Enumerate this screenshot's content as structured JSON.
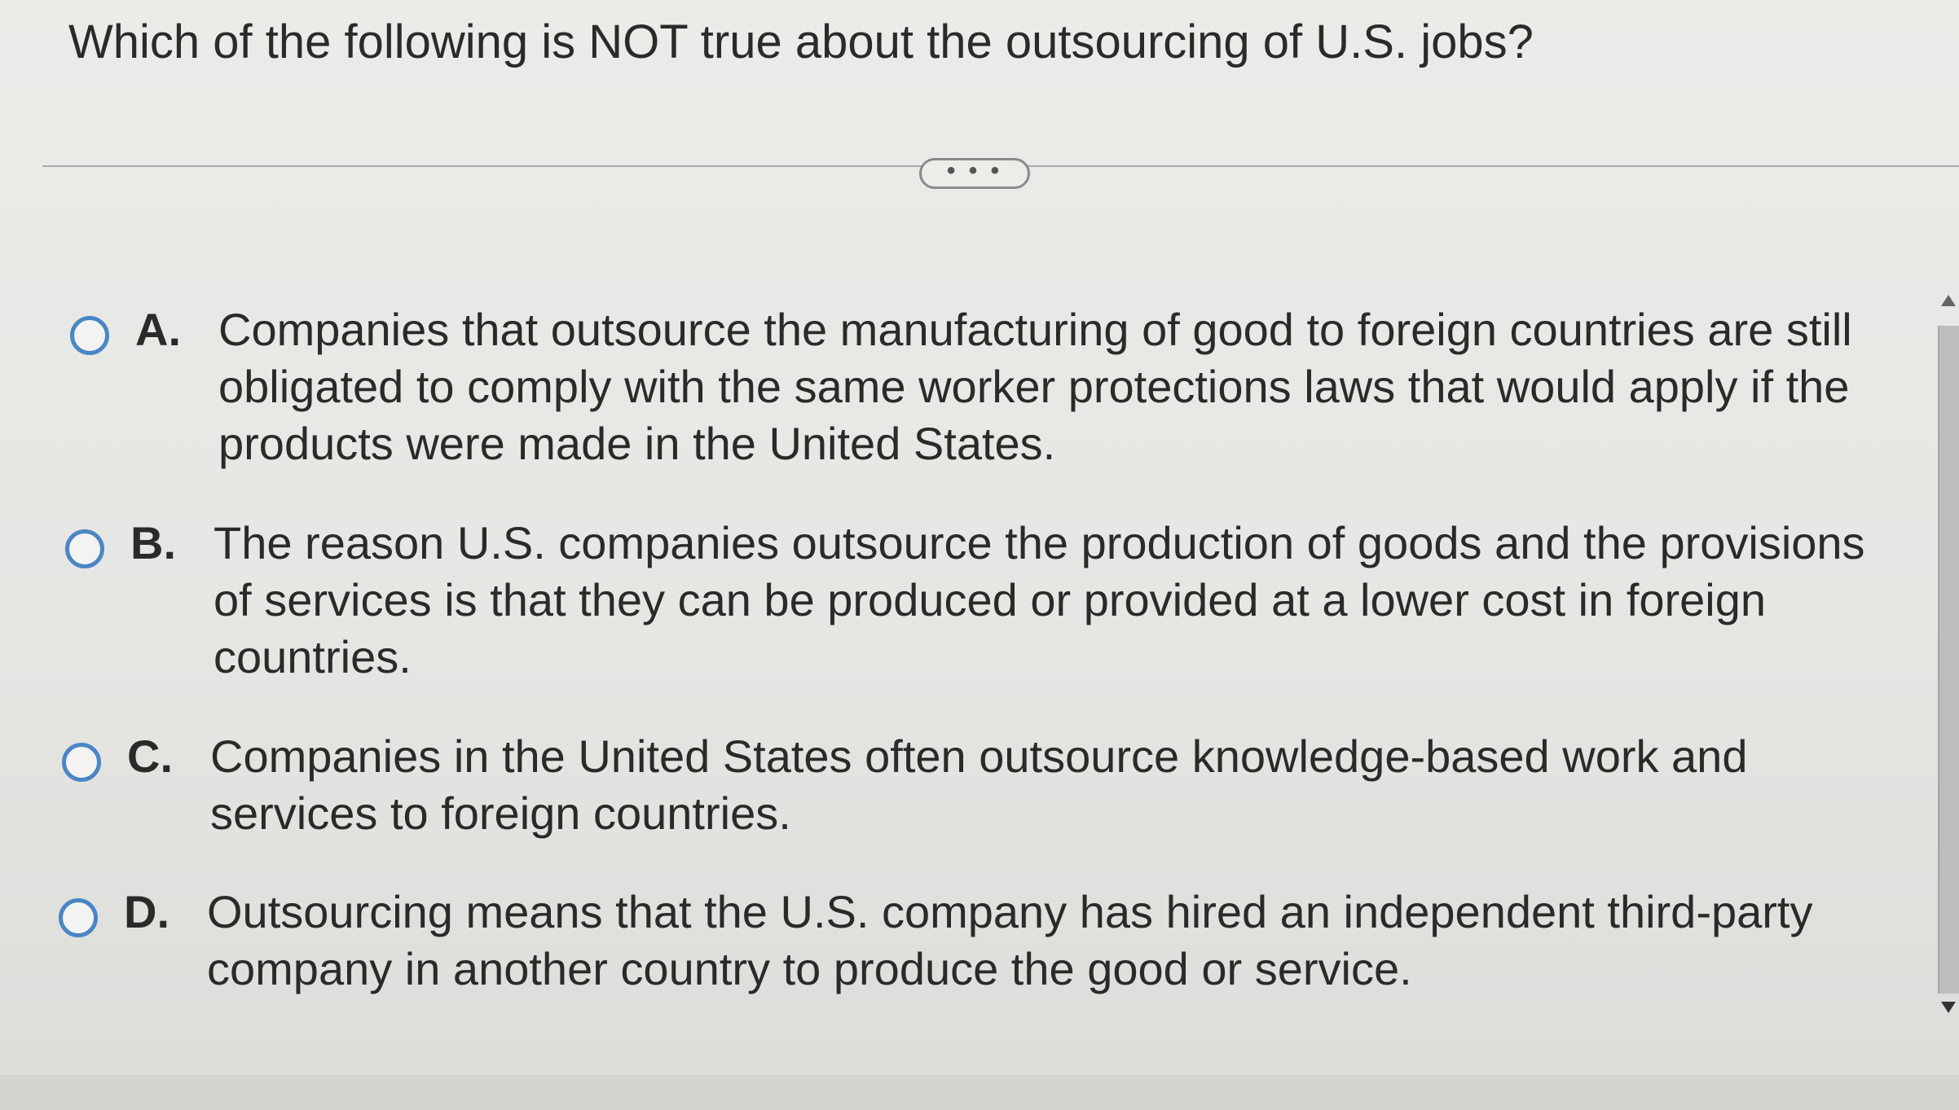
{
  "question": {
    "text": "Which of the following is NOT true about the outsourcing of U.S. jobs?"
  },
  "more_button": {
    "label": "• • •",
    "icon": "ellipsis-icon"
  },
  "options": [
    {
      "letter": "A.",
      "text": "Companies that outsource the manufacturing of good to foreign countries are still obligated to comply with the same worker protections laws that would apply if the products were made in the United States."
    },
    {
      "letter": "B.",
      "text": "The reason U.S. companies outsource the production of goods and the provisions of services is that they can be produced or provided at a lower cost in foreign countries."
    },
    {
      "letter": "C.",
      "text": "Companies in the United States often outsource knowledge-based work and services to foreign countries."
    },
    {
      "letter": "D.",
      "text": "Outsourcing means that the U.S. company has hired an independent third-party company in another country to produce the good or service."
    }
  ],
  "colors": {
    "radio_border": "#4a86c4",
    "background": "#e6e6e3",
    "text": "#2a2a2a"
  }
}
